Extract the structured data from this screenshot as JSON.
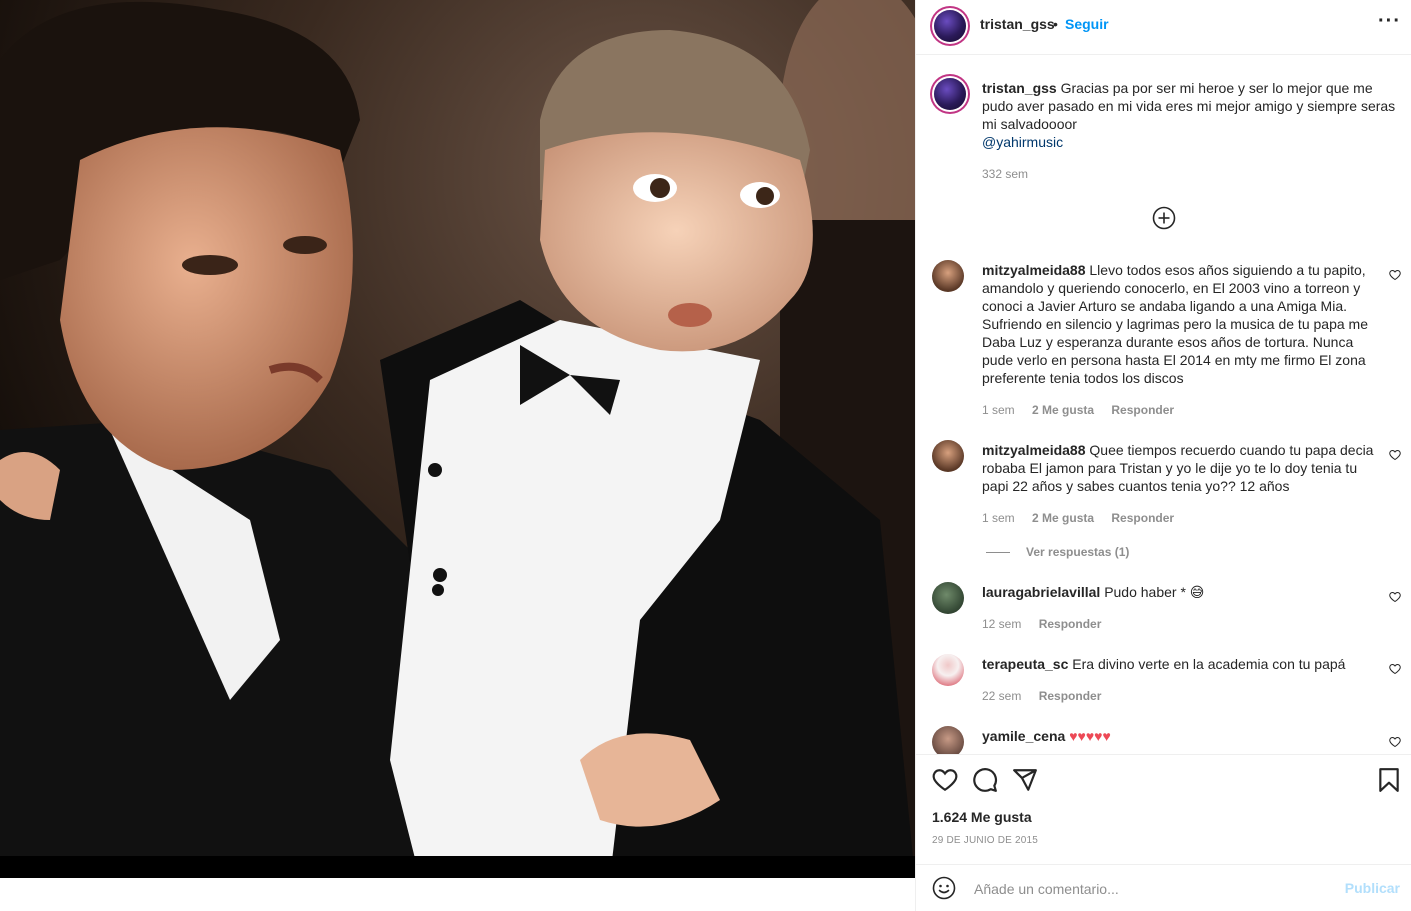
{
  "post": {
    "username": "tristan_gss",
    "separator": "•",
    "follow_label": "Seguir",
    "more_icon": "more-options-icon"
  },
  "caption": {
    "username": "tristan_gss",
    "text": "Gracias pa por ser mi heroe y ser lo mejor que me pudo aver pasado en mi vida eres mi mejor amigo y siempre seras mi salvadoooor",
    "mention": "@yahirmusic",
    "time": "332 sem"
  },
  "comments": [
    {
      "username": "mitzyalmeida88",
      "text": "Llevo todos esos años siguiendo a tu papito, amandolo y queriendo conocerlo, en El 2003 vino a torreon y conoci a Javier Arturo se andaba ligando a una Amiga Mia. Sufriendo en silencio y lagrimas pero la musica de tu papa me Daba Luz y esperanza durante esos años de tortura. Nunca pude verlo en persona hasta El 2014 en mty me firmo El zona preferente tenia todos los discos",
      "time": "1 sem",
      "likes": "2 Me gusta",
      "reply": "Responder"
    },
    {
      "username": "mitzyalmeida88",
      "text": "Quee tiempos recuerdo cuando tu papa decia robaba El jamon para Tristan y yo le dije yo te lo doy tenia tu papi 22 años y sabes cuantos tenia yo?? 12 años",
      "time": "1 sem",
      "likes": "2 Me gusta",
      "reply": "Responder",
      "view_replies": "Ver respuestas (1)"
    },
    {
      "username": "lauragabrielavillal",
      "text": "Pudo haber * 😅",
      "time": "12 sem",
      "reply": "Responder"
    },
    {
      "username": "terapeuta_sc",
      "text": "Era divino verte en la academia con tu papá",
      "time": "22 sem",
      "reply": "Responder"
    },
    {
      "username": "yamile_cena",
      "text": "♥♥♥♥♥"
    }
  ],
  "actions": {
    "like_icon": "heart-icon",
    "comment_icon": "comment-icon",
    "share_icon": "share-icon",
    "save_icon": "bookmark-icon",
    "likes_count": "1.624 Me gusta",
    "date": "29 DE JUNIO DE 2015"
  },
  "composer": {
    "emoji_icon": "emoji-icon",
    "placeholder": "Añade un comentario...",
    "publish_label": "Publicar"
  },
  "colors": {
    "accent": "#0095f6",
    "mention": "#00376b",
    "muted": "#8e8e8e",
    "publish_disabled": "#b2dffc",
    "heart_red": "#ed4956"
  }
}
